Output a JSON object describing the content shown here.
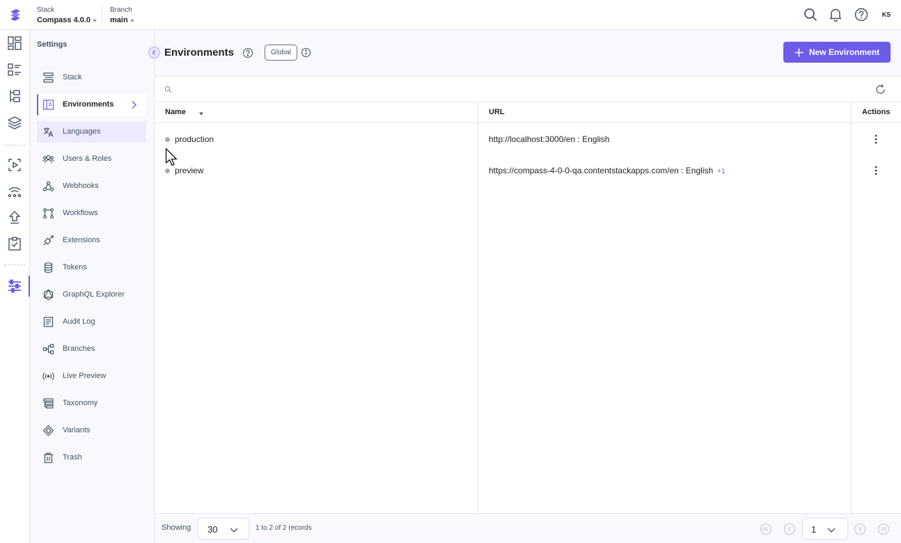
{
  "topbar": {
    "stack_label": "Stack",
    "stack_value": "Compass 4.0.0",
    "branch_label": "Branch",
    "branch_value": "main",
    "avatar_initials": "KS"
  },
  "sidebar": {
    "title": "Settings",
    "items": [
      {
        "label": "Stack",
        "icon": "stack-icon"
      },
      {
        "label": "Environments",
        "icon": "environments-icon"
      },
      {
        "label": "Languages",
        "icon": "languages-icon"
      },
      {
        "label": "Users & Roles",
        "icon": "users-icon"
      },
      {
        "label": "Webhooks",
        "icon": "webhooks-icon"
      },
      {
        "label": "Workflows",
        "icon": "workflows-icon"
      },
      {
        "label": "Extensions",
        "icon": "extensions-icon"
      },
      {
        "label": "Tokens",
        "icon": "tokens-icon"
      },
      {
        "label": "GraphQL Explorer",
        "icon": "graphql-icon"
      },
      {
        "label": "Audit Log",
        "icon": "audit-log-icon"
      },
      {
        "label": "Branches",
        "icon": "branches-icon"
      },
      {
        "label": "Live Preview",
        "icon": "live-preview-icon"
      },
      {
        "label": "Taxonomy",
        "icon": "taxonomy-icon"
      },
      {
        "label": "Variants",
        "icon": "variants-icon"
      },
      {
        "label": "Trash",
        "icon": "trash-icon"
      }
    ],
    "active_index": 1,
    "hover_index": 2
  },
  "header": {
    "title": "Environments",
    "tag": "Global",
    "new_button": "New Environment"
  },
  "search": {
    "placeholder": ""
  },
  "table": {
    "columns": [
      "Name",
      "URL",
      "Actions"
    ],
    "rows": [
      {
        "name": "production",
        "url": "http://localhost:3000/en : English",
        "extra": ""
      },
      {
        "name": "preview",
        "url": "https://compass-4-0-0-qa.contentstackapps.com/en : English",
        "extra": "+1"
      }
    ]
  },
  "footer": {
    "showing_label": "Showing",
    "page_size": "30",
    "records": "1 to 2 of 2 records",
    "page": "1"
  },
  "colors": {
    "accent": "#6c5ce7",
    "sidebar_bg": "#f7f9fc",
    "border": "#e3e6ee"
  }
}
